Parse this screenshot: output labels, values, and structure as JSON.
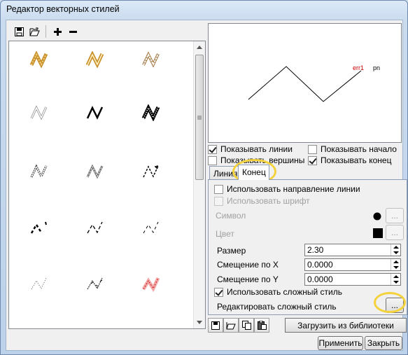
{
  "window": {
    "title": "Редактор векторных стилей"
  },
  "preview": {
    "label_end": "err1",
    "label_pn": "pn"
  },
  "checkboxes": {
    "show_lines": {
      "label": "Показывать линии",
      "checked": true
    },
    "show_start": {
      "label": "Показывать начало",
      "checked": false
    },
    "show_vertices": {
      "label": "Показывать вершины",
      "checked": false
    },
    "show_end": {
      "label": "Показывать конец",
      "checked": true
    }
  },
  "tabs": {
    "line": "Линия",
    "end": "Конец"
  },
  "end_tab": {
    "use_direction": "Использовать направление линии",
    "use_font": "Использовать шрифт",
    "symbol_label": "Символ",
    "color_label": "Цвет",
    "size_label": "Размер",
    "size_value": "2.30",
    "offset_x_label": "Смещение по X",
    "offset_x_value": "0.0000",
    "offset_y_label": "Смещение по Y",
    "offset_y_value": "0.0000",
    "use_complex": "Использовать сложный стиль",
    "edit_complex": "Редактировать сложный стиль",
    "dots_button": "..."
  },
  "load_library_button": "Загрузить из библиотеки",
  "apply_button": "Применить",
  "close_button": "Закрыть",
  "icons": [
    "save-icon",
    "open-icon",
    "plus-icon",
    "minus-icon",
    "copy-icon",
    "paste-icon"
  ]
}
